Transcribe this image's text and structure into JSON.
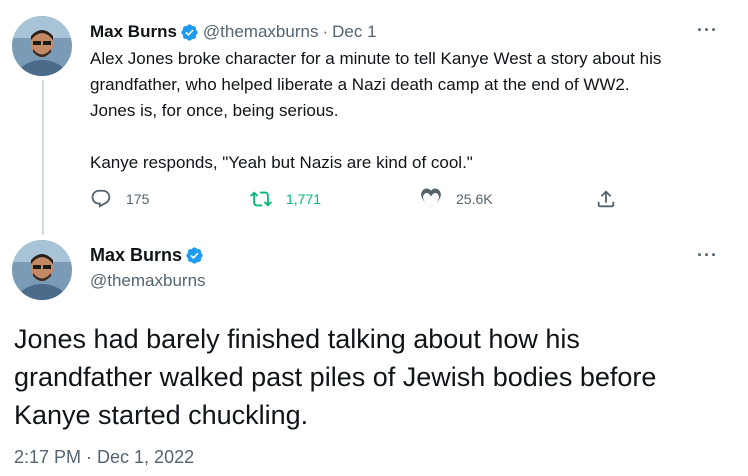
{
  "tweet1": {
    "author_name": "Max Burns",
    "handle": "@themaxburns",
    "separator": "·",
    "date": "Dec 1",
    "more": "···",
    "lines": [
      "Alex Jones broke character for a minute to tell Kanye West a story about his",
      "grandfather, who helped liberate a Nazi death camp at the end of WW2.",
      "Jones is, for once, being serious."
    ],
    "quote_line": "Kanye responds, \"Yeah but Nazis are kind of cool.\"",
    "replies": "175",
    "retweets": "1,771",
    "likes": "25.6K",
    "icons": [
      "reply-icon",
      "retweet-icon",
      "like-icon",
      "share-icon"
    ]
  },
  "tweet2": {
    "author_name": "Max Burns",
    "handle": "@themaxburns",
    "more": "···",
    "lines": [
      "Jones had barely finished talking about how his",
      "grandfather walked past piles of Jewish bodies before",
      "Kanye started chuckling."
    ],
    "timestamp": "2:17 PM · Dec 1, 2022"
  },
  "colors": {
    "verified": "#1d9bf0",
    "muted": "#536471",
    "retweet_green": "#00ba7c",
    "thread_line": "#cfd9de"
  }
}
